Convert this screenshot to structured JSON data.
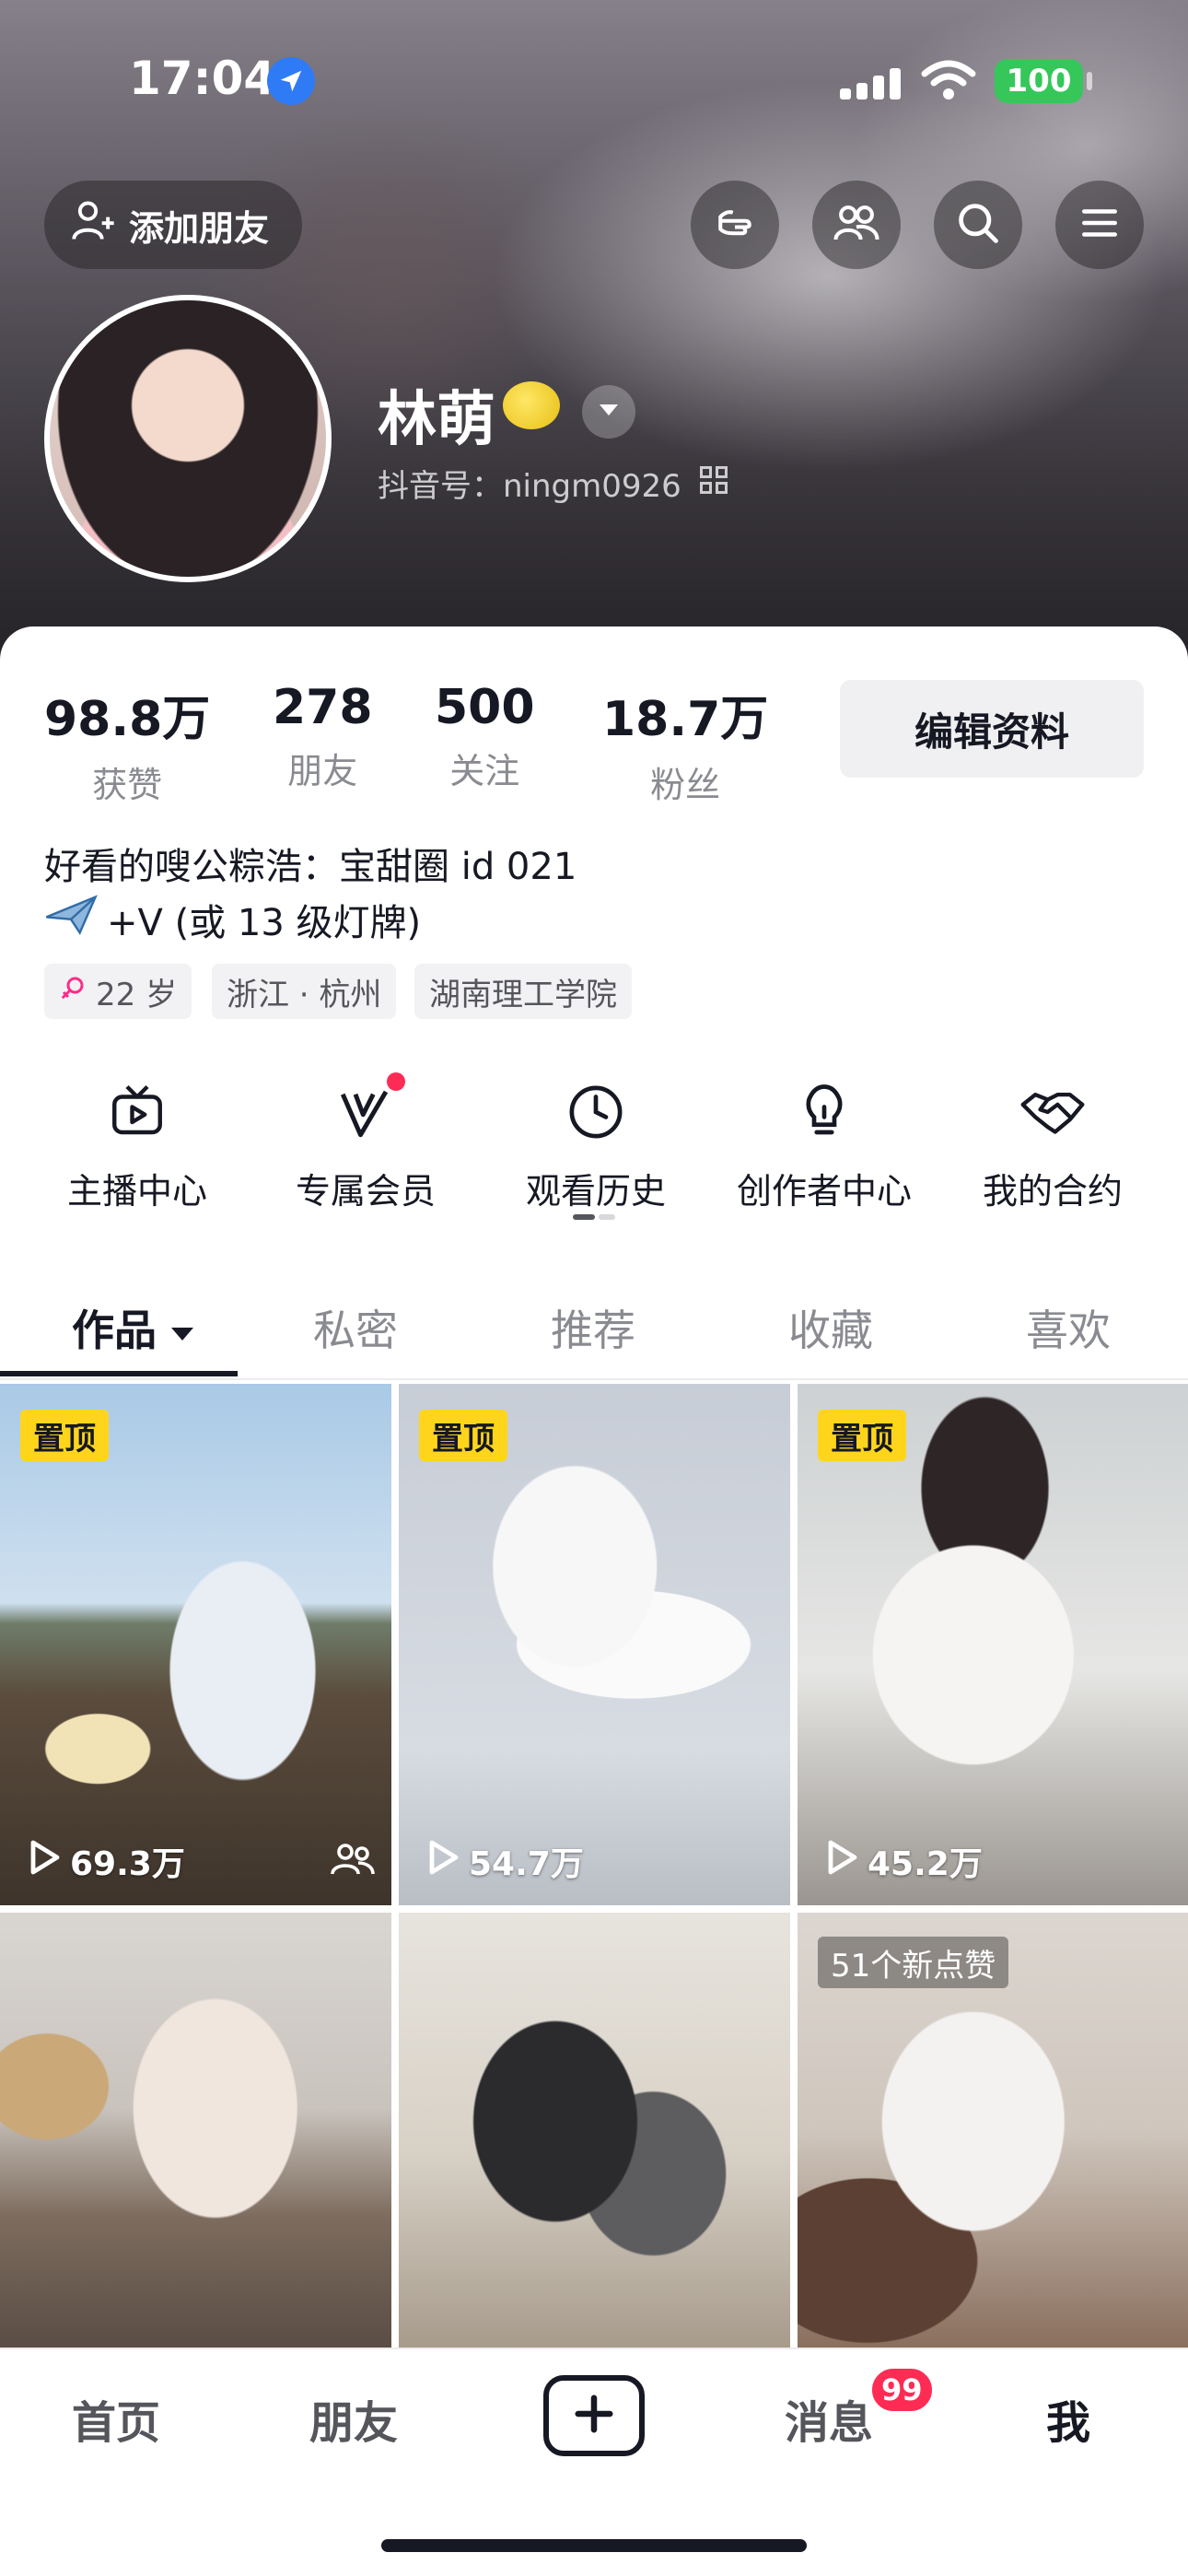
{
  "status_bar": {
    "time": "17:04",
    "battery": "100"
  },
  "header": {
    "add_friend_label": "添加朋友",
    "name": "林萌",
    "douyin_id": "抖音号：ningm0926"
  },
  "stats": [
    {
      "value": "98.8万",
      "label": "获赞"
    },
    {
      "value": "278",
      "label": "朋友"
    },
    {
      "value": "500",
      "label": "关注"
    },
    {
      "value": "18.7万",
      "label": "粉丝"
    }
  ],
  "edit_profile_label": "编辑资料",
  "bio": {
    "line1": "好看的嗖公粽浩：宝甜圈 id 021",
    "line2": "+V (或 13 级灯牌)"
  },
  "tags": {
    "age": "22 岁",
    "location": "浙江 · 杭州",
    "school": "湖南理工学院"
  },
  "shortcuts": [
    {
      "label": "主播中心",
      "icon": "tv-icon"
    },
    {
      "label": "专属会员",
      "icon": "vip-v-icon"
    },
    {
      "label": "观看历史",
      "icon": "clock-icon"
    },
    {
      "label": "创作者中心",
      "icon": "lightbulb-icon"
    },
    {
      "label": "我的合约",
      "icon": "handshake-icon"
    }
  ],
  "tabs": [
    "作品",
    "私密",
    "推荐",
    "收藏",
    "喜欢"
  ],
  "posts": [
    {
      "pinned": "置顶",
      "plays": "69.3万"
    },
    {
      "pinned": "置顶",
      "plays": "54.7万"
    },
    {
      "pinned": "置顶",
      "plays": "45.2万"
    },
    {
      "overlay": ""
    },
    {
      "overlay": ""
    },
    {
      "overlay": "51个新点赞"
    }
  ],
  "bottom_nav": {
    "home": "首页",
    "friends": "朋友",
    "messages": "消息",
    "messages_badge": "99",
    "me": "我"
  },
  "colors": {
    "accent_red": "#fe2c55",
    "pin_yellow": "#ffd51c",
    "battery_green": "#35c75a"
  }
}
